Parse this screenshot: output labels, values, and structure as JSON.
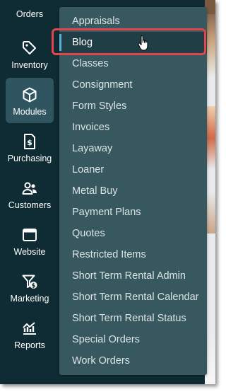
{
  "sidebar": {
    "items": [
      {
        "label": "Orders",
        "icon": "orders-icon"
      },
      {
        "label": "Inventory",
        "icon": "tag-icon"
      },
      {
        "label": "Modules",
        "icon": "cube-icon",
        "active": true
      },
      {
        "label": "Purchasing",
        "icon": "invoice-dollar-icon"
      },
      {
        "label": "Customers",
        "icon": "users-icon"
      },
      {
        "label": "Website",
        "icon": "browser-window-icon"
      },
      {
        "label": "Marketing",
        "icon": "funnel-dollar-icon"
      },
      {
        "label": "Reports",
        "icon": "chart-line-icon"
      }
    ]
  },
  "modules_menu": {
    "selected": "Blog",
    "items": [
      "Appraisals",
      "Blog",
      "Classes",
      "Consignment",
      "Form Styles",
      "Invoices",
      "Layaway",
      "Loaner",
      "Metal Buy",
      "Payment Plans",
      "Quotes",
      "Restricted Items",
      "Short Term Rental Admin",
      "Short Term Rental Calendar",
      "Short Term Rental Status",
      "Special Orders",
      "Work Orders"
    ]
  },
  "colors": {
    "sidebar_bg": "#0f2b33",
    "menu_bg": "#37585f",
    "active_nav_bg": "#2f5560",
    "selected_item_bg": "#203e46",
    "selected_accent": "#5bb3d8",
    "callout_red": "#e2454b"
  }
}
